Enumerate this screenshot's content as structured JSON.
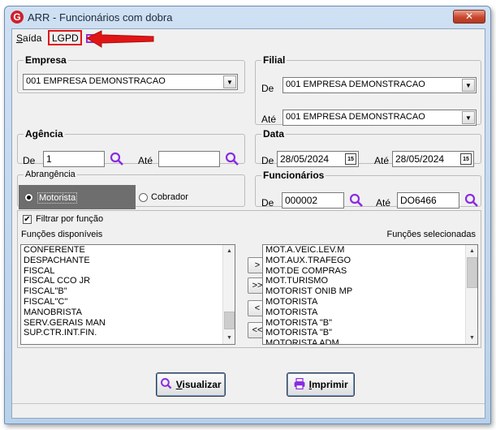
{
  "window": {
    "title": "ARR - Funcionários com dobra",
    "logo_letter": "G",
    "close_glyph": "✕"
  },
  "menu": {
    "saida_first": "S",
    "saida_rest": "aída",
    "lgpd": "LGPD"
  },
  "empresa": {
    "legend": "Empresa",
    "value": "001 EMPRESA DEMONSTRACAO"
  },
  "filial": {
    "legend": "Filial",
    "de_label": "De",
    "de_value": "001 EMPRESA DEMONSTRACAO",
    "ate_label": "Até",
    "ate_value": "001 EMPRESA DEMONSTRACAO"
  },
  "agencia": {
    "legend": "Agência",
    "de_label": "De",
    "de_value": "1",
    "ate_label": "Até",
    "ate_value": ""
  },
  "data": {
    "legend": "Data",
    "de_label": "De",
    "de_value": "28/05/2024",
    "ate_label": "Até",
    "ate_value": "28/05/2024",
    "cal_badge": "15"
  },
  "abrangencia": {
    "legend": "Abrangência",
    "option_motorista": "Motorista",
    "option_cobrador": "Cobrador",
    "selected": "Motorista"
  },
  "funcionarios": {
    "legend": "Funcionários",
    "de_label": "De",
    "de_value": "000002",
    "ate_label": "Até",
    "ate_value": "DO6466"
  },
  "funcoes": {
    "filter_label": "Filtrar por função",
    "filter_checked": true,
    "available_label": "Funções disponíveis",
    "selected_label": "Funções selecionadas",
    "available": [
      "CONFERENTE",
      "DESPACHANTE",
      "FISCAL",
      "FISCAL CCO JR",
      "FISCAL\"B\"",
      "FISCAL\"C\"",
      "MANOBRISTA",
      "SERV.GERAIS MAN",
      "SUP.CTR.INT.FIN."
    ],
    "selected": [
      "MOT.A.VEIC.LEV.M",
      "MOT.AUX.TRAFEGO",
      "MOT.DE COMPRAS",
      "MOT.TURISMO",
      "MOTORIST ONIB MP",
      "MOTORISTA",
      "MOTORISTA",
      "MOTORISTA \"B\"",
      "MOTORISTA \"B\"",
      "MOTORISTA ADM"
    ],
    "buttons": {
      "add": ">",
      "add_all": ">>",
      "remove": "<",
      "remove_all": "<<"
    }
  },
  "actions": {
    "visualizar_first": "V",
    "visualizar_rest": "isualizar",
    "imprimir_first": "I",
    "imprimir_rest": "mprimir"
  },
  "colors": {
    "accent_purple": "#8a2be2",
    "annotation_red": "#e01616"
  }
}
